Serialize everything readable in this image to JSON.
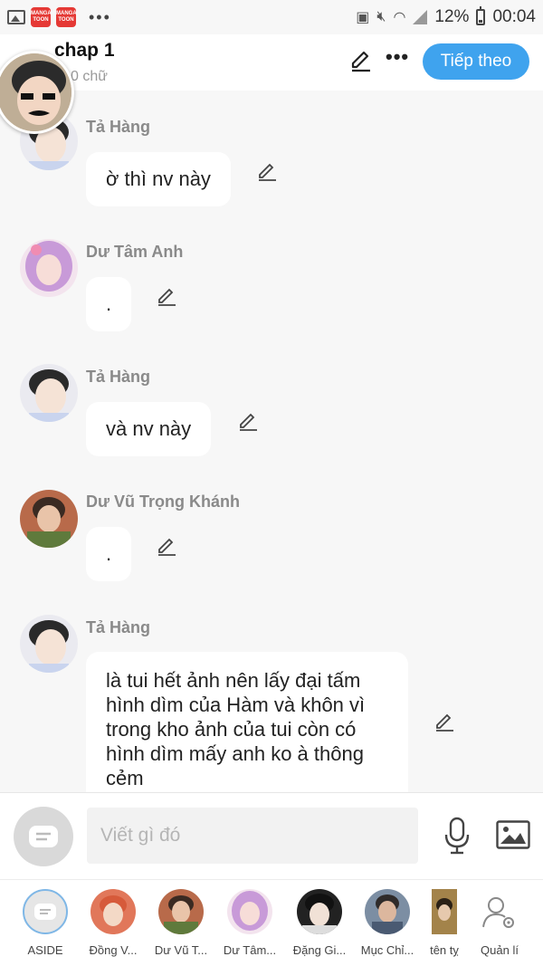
{
  "status_bar": {
    "battery": "12%",
    "time": "00:04",
    "app_badge": "MANGA TOON"
  },
  "header": {
    "title": "chap 1",
    "subtitle": "0 chữ",
    "next_label": "Tiếp theo"
  },
  "messages": [
    {
      "author": "Tả Hàng",
      "text": "ờ thì nv này"
    },
    {
      "author": "Dư Tâm Anh",
      "text": "."
    },
    {
      "author": "Tả Hàng",
      "text": "và nv này"
    },
    {
      "author": "Dư Vũ Trọng Khánh",
      "text": "."
    },
    {
      "author": "Tả Hàng",
      "text": "là tui hết ảnh nên lấy đại tấm hình dìm của Hàm và khôn vì trong kho ảnh của tui còn có hình dìm mấy anh ko à thông cẻm"
    }
  ],
  "input": {
    "placeholder": "Viết gì đó"
  },
  "characters": [
    {
      "label": "ASIDE"
    },
    {
      "label": "Đồng V..."
    },
    {
      "label": "Dư Vũ T..."
    },
    {
      "label": "Dư Tâm..."
    },
    {
      "label": "Đặng Gi..."
    },
    {
      "label": "Mục Chỉ..."
    },
    {
      "label": "tên tỵ"
    },
    {
      "label": "Quản lí"
    }
  ],
  "colors": {
    "accent": "#3fa3ee",
    "background": "#f7f7f7",
    "bubble": "#ffffff",
    "name_text": "#8a8a8a"
  }
}
